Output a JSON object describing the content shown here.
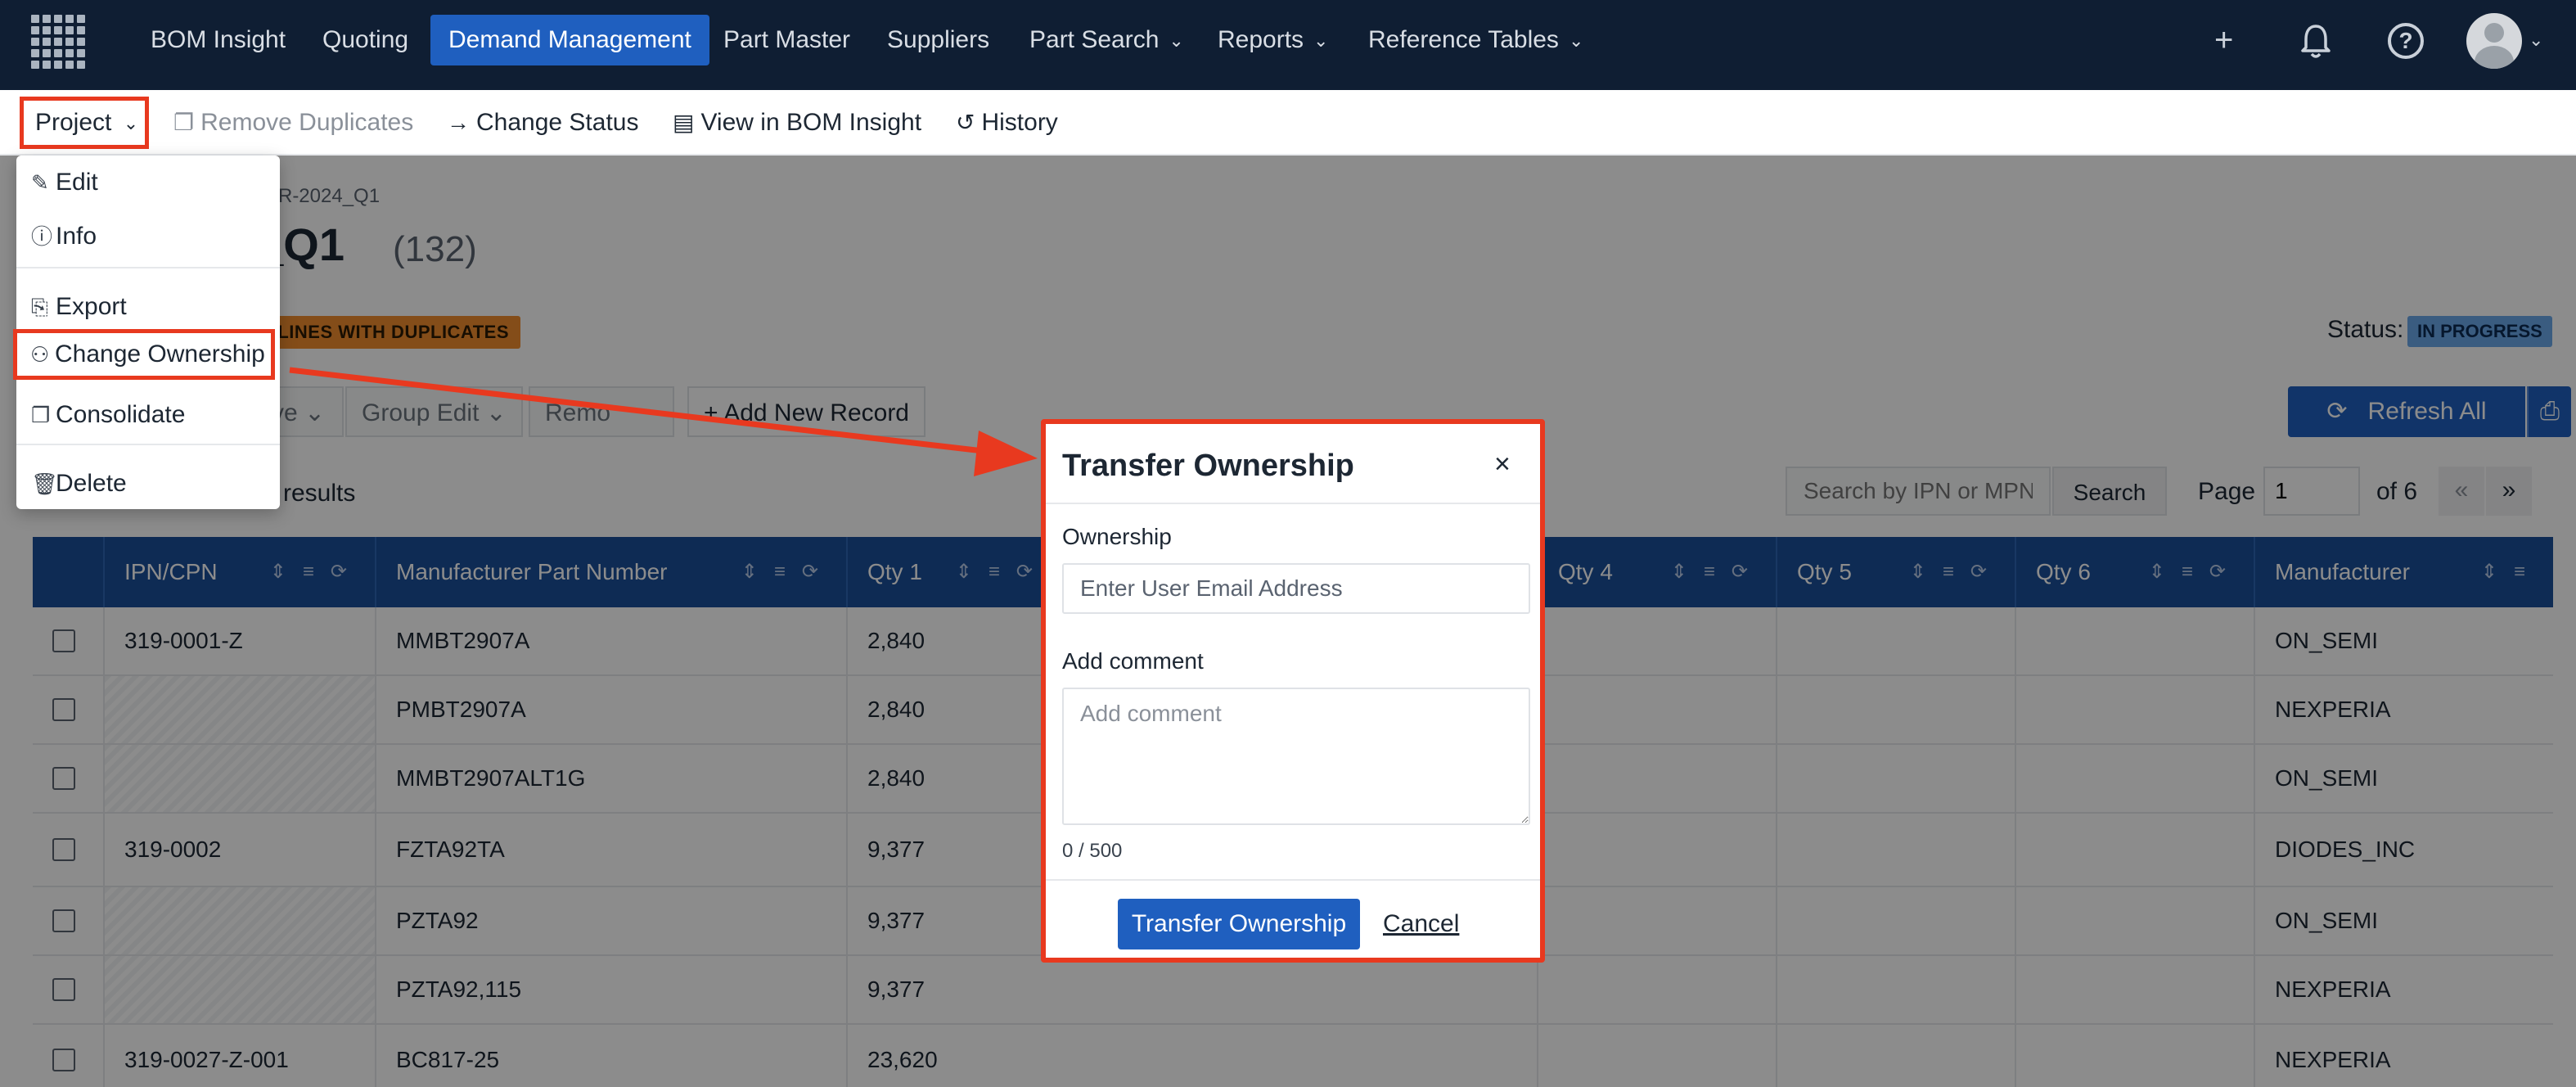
{
  "topnav": {
    "items": [
      {
        "label": "BOM Insight",
        "active": false,
        "dropdown": false
      },
      {
        "label": "Quoting",
        "active": false,
        "dropdown": false
      },
      {
        "label": "Demand Management",
        "active": true,
        "dropdown": false
      },
      {
        "label": "Part Master",
        "active": false,
        "dropdown": false
      },
      {
        "label": "Suppliers",
        "active": false,
        "dropdown": false
      },
      {
        "label": "Part Search",
        "active": false,
        "dropdown": true
      },
      {
        "label": "Reports",
        "active": false,
        "dropdown": true
      },
      {
        "label": "Reference Tables",
        "active": false,
        "dropdown": true
      }
    ],
    "icons": [
      "plus-icon",
      "bell-icon",
      "help-icon",
      "avatar"
    ]
  },
  "toolbar": {
    "project_label": "Project",
    "remove_duplicates_label": "Remove Duplicates",
    "change_status_label": "Change Status",
    "view_in_bom_label": "View in BOM Insight",
    "history_label": "History"
  },
  "page": {
    "breadcrumb_partial": "MMR-2024_Q1",
    "title_partial": "4_Q1",
    "count": "(132)",
    "dup_badge_partial": "0 LINES WITH DUPLICATES",
    "status_label": "Status:",
    "status_value": "IN PROGRESS"
  },
  "actions": {
    "move_partial": "ve",
    "group_edit_label": "Group Edit",
    "remove_partial": "Remo",
    "add_record_label": "Add New Record",
    "refresh_label": "Refresh All"
  },
  "results": {
    "text_partial": "results",
    "search_placeholder": "Search by IPN or MPN",
    "search_button": "Search",
    "page_label": "Page",
    "page_value": "1",
    "page_of": "of 6",
    "prev": "«",
    "next": "»"
  },
  "table": {
    "columns": [
      "IPN/CPN",
      "Manufacturer Part Number",
      "Qty 1",
      "Qty 4",
      "Qty 5",
      "Qty 6",
      "Manufacturer"
    ],
    "rows": [
      {
        "ipn": "319-0001-Z",
        "mpn": "MMBT2907A",
        "qty1": "2,840",
        "mfr": "ON_SEMI"
      },
      {
        "ipn": "",
        "mpn": "PMBT2907A",
        "qty1": "2,840",
        "mfr": "NEXPERIA"
      },
      {
        "ipn": "",
        "mpn": "MMBT2907ALT1G",
        "qty1": "2,840",
        "mfr": "ON_SEMI"
      },
      {
        "ipn": "319-0002",
        "mpn": "FZTA92TA",
        "qty1": "9,377",
        "mfr": "DIODES_INC"
      },
      {
        "ipn": "",
        "mpn": "PZTA92",
        "qty1": "9,377",
        "mfr": "ON_SEMI"
      },
      {
        "ipn": "",
        "mpn": "PZTA92,115",
        "qty1": "9,377",
        "mfr": "NEXPERIA"
      },
      {
        "ipn": "319-0027-Z-001",
        "mpn": "BC817-25",
        "qty1": "23,620",
        "mfr": "NEXPERIA"
      }
    ]
  },
  "project_menu": {
    "items": [
      "Edit",
      "Info",
      "Export",
      "Change Ownership",
      "Consolidate",
      "Delete"
    ]
  },
  "modal": {
    "title": "Transfer Ownership",
    "close": "×",
    "ownership_label": "Ownership",
    "email_placeholder": "Enter User Email Address",
    "comment_label": "Add comment",
    "comment_placeholder": "Add comment",
    "char_count": "0 / 500",
    "submit_label": "Transfer Ownership",
    "cancel_label": "Cancel"
  },
  "colors": {
    "nav_bg": "#0f1e33",
    "accent": "#1f5fbf",
    "highlight_red": "#e8391f",
    "dup_badge": "#f08c2f",
    "status_badge": "#6aa8ea"
  }
}
